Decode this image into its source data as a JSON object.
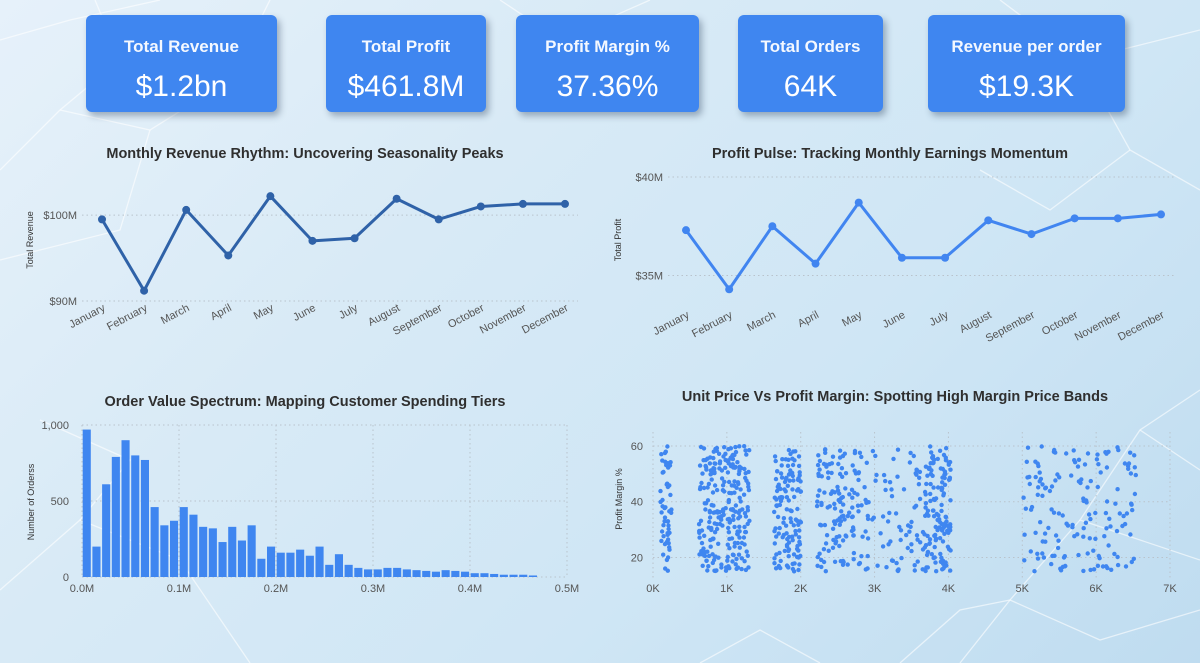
{
  "kpis": [
    {
      "title": "Total Revenue",
      "value": "$1.2bn"
    },
    {
      "title": "Total Profit",
      "value": "$461.8M"
    },
    {
      "title": "Profit Margin %",
      "value": "37.36%"
    },
    {
      "title": "Total Orders",
      "value": "64K"
    },
    {
      "title": "Revenue per order",
      "value": "$19.3K"
    }
  ],
  "colors": {
    "kpi_bg": "#3f86f0",
    "revenue_line": "#2f62a8",
    "profit_line": "#4185f0",
    "bars": "#3f86f0",
    "scatter": "#3f86f0",
    "axis_text": "#555555",
    "grid": "#b9c3cc"
  },
  "chart_data": [
    {
      "type": "line",
      "title": "Monthly Revenue Rhythm: Uncovering Seasonality Peaks",
      "xlabel": "",
      "ylabel": "Total Revenue",
      "categories": [
        "January",
        "February",
        "March",
        "April",
        "May",
        "June",
        "July",
        "August",
        "September",
        "October",
        "November",
        "December"
      ],
      "values": [
        99.5,
        91.2,
        100.6,
        95.3,
        102.2,
        97.0,
        97.3,
        101.9,
        99.5,
        101.0,
        101.3,
        101.3
      ],
      "yticks": [
        {
          "value": 90,
          "label": "$90M"
        },
        {
          "value": 100,
          "label": "$100M"
        }
      ],
      "ylim": [
        90,
        103.5
      ],
      "grid": true
    },
    {
      "type": "line",
      "title": "Profit Pulse: Tracking Monthly Earnings Momentum",
      "xlabel": "",
      "ylabel": "Total Profit",
      "categories": [
        "January",
        "February",
        "March",
        "April",
        "May",
        "June",
        "July",
        "August",
        "September",
        "October",
        "November",
        "December"
      ],
      "values": [
        37.3,
        34.3,
        37.5,
        35.6,
        38.7,
        35.9,
        35.9,
        37.8,
        37.1,
        37.9,
        37.9,
        38.1
      ],
      "yticks": [
        {
          "value": 35,
          "label": "$35M"
        },
        {
          "value": 40,
          "label": "$40M"
        }
      ],
      "ylim": [
        33.5,
        40
      ],
      "grid": true
    },
    {
      "type": "bar",
      "title": "Order Value Spectrum: Mapping Customer Spending Tiers",
      "xlabel": "",
      "ylabel": "Number of Orderss",
      "bin_width": 0.01,
      "bin_starts": [
        0.0,
        0.01,
        0.02,
        0.03,
        0.04,
        0.05,
        0.06,
        0.07,
        0.08,
        0.09,
        0.1,
        0.11,
        0.12,
        0.13,
        0.14,
        0.15,
        0.16,
        0.17,
        0.18,
        0.19,
        0.2,
        0.21,
        0.22,
        0.23,
        0.24,
        0.25,
        0.26,
        0.27,
        0.28,
        0.29,
        0.3,
        0.31,
        0.32,
        0.33,
        0.34,
        0.35,
        0.36,
        0.37,
        0.38,
        0.39,
        0.4,
        0.41,
        0.42,
        0.43,
        0.44,
        0.45,
        0.46
      ],
      "values": [
        970,
        200,
        610,
        790,
        900,
        800,
        770,
        460,
        340,
        370,
        460,
        410,
        330,
        320,
        230,
        330,
        240,
        340,
        120,
        200,
        160,
        160,
        180,
        140,
        200,
        80,
        150,
        80,
        60,
        50,
        50,
        60,
        60,
        50,
        45,
        40,
        35,
        45,
        40,
        35,
        25,
        25,
        20,
        15,
        15,
        15,
        10
      ],
      "xticks": [
        {
          "value": 0,
          "label": "0.0M"
        },
        {
          "value": 0.1,
          "label": "0.1M"
        },
        {
          "value": 0.2,
          "label": "0.2M"
        },
        {
          "value": 0.3,
          "label": "0.3M"
        },
        {
          "value": 0.4,
          "label": "0.4M"
        },
        {
          "value": 0.5,
          "label": "0.5M"
        }
      ],
      "yticks": [
        {
          "value": 0,
          "label": "0"
        },
        {
          "value": 500,
          "label": "500"
        },
        {
          "value": 1000,
          "label": "1,000"
        }
      ],
      "xlim": [
        0,
        0.5
      ],
      "ylim": [
        0,
        1000
      ],
      "grid": true
    },
    {
      "type": "scatter",
      "title": "Unit Price Vs Profit Margin: Spotting High Margin Price Bands",
      "xlabel": "",
      "ylabel": "Profit Margin %",
      "bands": [
        {
          "x_range": [
            100,
            250
          ],
          "y_range": [
            15,
            60
          ],
          "density": "high"
        },
        {
          "x_range": [
            620,
            1310
          ],
          "y_range": [
            15,
            60
          ],
          "density": "high"
        },
        {
          "x_range": [
            1640,
            2010
          ],
          "y_range": [
            15,
            60
          ],
          "density": "high"
        },
        {
          "x_range": [
            2220,
            2750
          ],
          "y_range": [
            15,
            60
          ],
          "density": "medium"
        },
        {
          "x_range": [
            2750,
            3650
          ],
          "y_range": [
            15,
            60
          ],
          "density": "low"
        },
        {
          "x_range": [
            3650,
            4030
          ],
          "y_range": [
            15,
            60
          ],
          "density": "high"
        },
        {
          "x_range": [
            5000,
            6570
          ],
          "y_range": [
            15,
            60
          ],
          "density": "low"
        }
      ],
      "xticks": [
        {
          "value": 0,
          "label": "0K"
        },
        {
          "value": 1000,
          "label": "1K"
        },
        {
          "value": 2000,
          "label": "2K"
        },
        {
          "value": 3000,
          "label": "3K"
        },
        {
          "value": 4000,
          "label": "4K"
        },
        {
          "value": 5000,
          "label": "5K"
        },
        {
          "value": 6000,
          "label": "6K"
        },
        {
          "value": 7000,
          "label": "7K"
        }
      ],
      "yticks": [
        {
          "value": 20,
          "label": "20"
        },
        {
          "value": 40,
          "label": "40"
        },
        {
          "value": 60,
          "label": "60"
        }
      ],
      "xlim": [
        0,
        7000
      ],
      "ylim": [
        13,
        65
      ],
      "grid": true
    }
  ]
}
